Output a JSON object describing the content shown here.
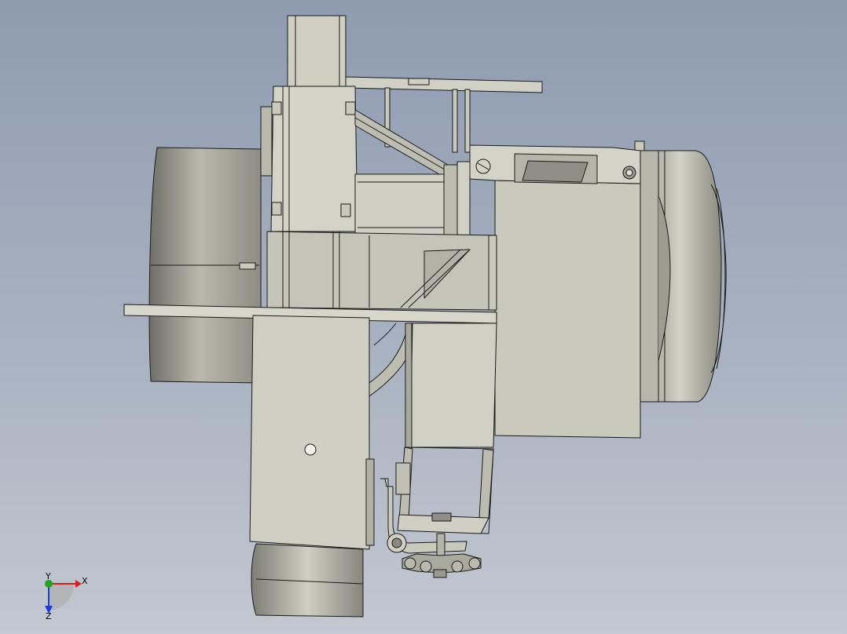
{
  "viewport": {
    "background_top": "#8e9bb0",
    "background_bottom": "#c3c8d1",
    "part_fill": "#c9c9bc",
    "part_stroke": "#1b1b1b"
  },
  "triad": {
    "x_label": "X",
    "y_label": "Y",
    "z_label": "Z",
    "x_color": "#d81e1e",
    "y_color": "#1fa51f",
    "z_color": "#1e3ad8"
  }
}
